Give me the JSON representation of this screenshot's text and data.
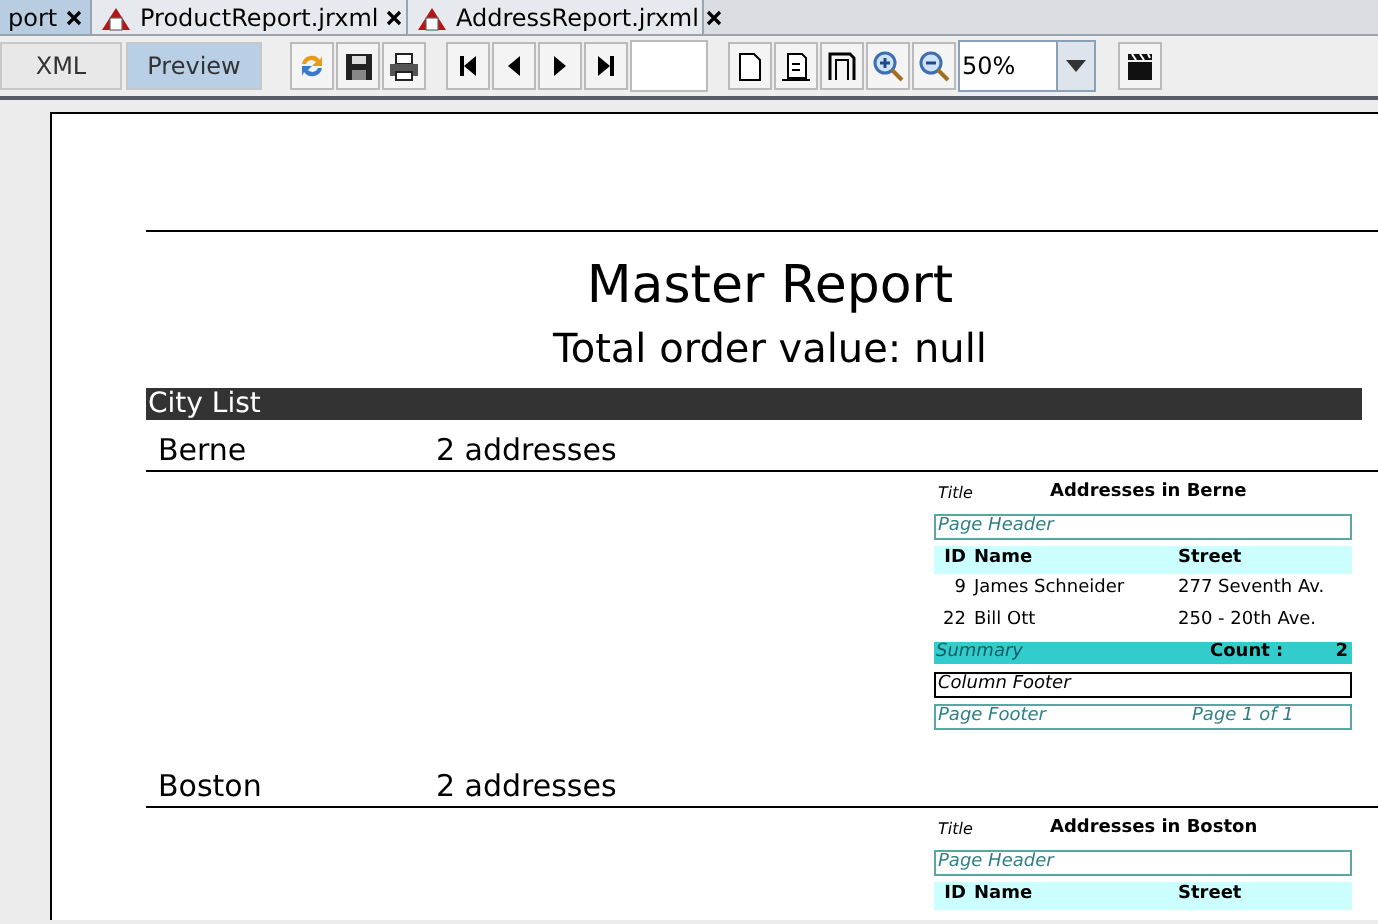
{
  "tabs": [
    {
      "label": "port",
      "selected": true,
      "has_icon": false
    },
    {
      "label": "ProductReport.jrxml",
      "selected": false,
      "has_icon": true
    },
    {
      "label": "AddressReport.jrxml",
      "selected": false,
      "has_icon": true
    }
  ],
  "view_buttons": [
    {
      "label": "XML",
      "selected": false
    },
    {
      "label": "Preview",
      "selected": true
    }
  ],
  "zoom_field": {
    "value": "50%"
  },
  "report": {
    "title": "Master Report",
    "subtitle": "Total order value: null",
    "section_header": "City List",
    "groups": [
      {
        "city": "Berne",
        "count_text": "2 addresses",
        "subreport": {
          "title_label": "Title",
          "title": "Addresses in Berne",
          "page_header": "Page Header",
          "columns": [
            "ID",
            "Name",
            "Street"
          ],
          "rows": [
            [
              "9",
              "James Schneider",
              "277 Seventh Av."
            ],
            [
              "22",
              "Bill Ott",
              "250 - 20th Ave."
            ]
          ],
          "summary_label": "Summary",
          "count_label": "Count :",
          "count": "2",
          "column_footer": "Column Footer",
          "page_footer": "Page Footer",
          "page_number": "Page 1 of 1"
        }
      },
      {
        "city": "Boston",
        "count_text": "2 addresses",
        "subreport": {
          "title_label": "Title",
          "title": "Addresses in Boston",
          "page_header": "Page Header",
          "columns": [
            "ID",
            "Name",
            "Street"
          ]
        }
      }
    ]
  }
}
